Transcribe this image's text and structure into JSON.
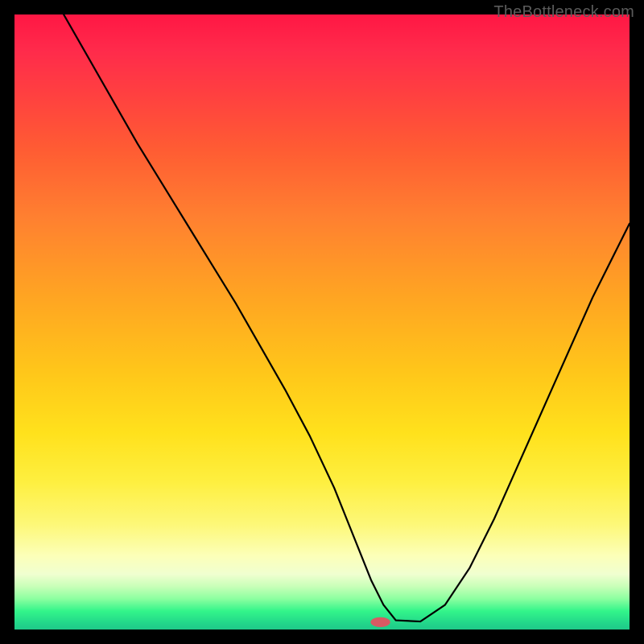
{
  "watermark": "TheBottleneck.com",
  "chart_data": {
    "type": "line",
    "title": "",
    "xlabel": "",
    "ylabel": "",
    "xlim": [
      0,
      100
    ],
    "ylim": [
      0,
      100
    ],
    "grid": false,
    "series": [
      {
        "name": "bottleneck-curve",
        "x": [
          8,
          12,
          16,
          20,
          24,
          28,
          32,
          36,
          40,
          44,
          48,
          52,
          54,
          56,
          58,
          60,
          62,
          66,
          70,
          74,
          78,
          82,
          86,
          90,
          94,
          98,
          100
        ],
        "values": [
          100,
          93,
          86,
          79,
          72.5,
          66,
          59.5,
          53,
          46,
          39,
          31.5,
          23,
          18,
          13,
          8,
          4,
          1.5,
          1.3,
          4,
          10,
          18,
          27,
          36,
          45,
          54,
          62,
          66
        ]
      }
    ],
    "marker": {
      "x": 59.5,
      "y": 1.2,
      "rx": 1.6,
      "ry": 0.8,
      "color": "#d85a63"
    },
    "background_gradient": {
      "stops": [
        {
          "pct": 0,
          "color": "#ff1744"
        },
        {
          "pct": 6,
          "color": "#ff2b4b"
        },
        {
          "pct": 13,
          "color": "#ff4040"
        },
        {
          "pct": 22,
          "color": "#ff5c33"
        },
        {
          "pct": 33,
          "color": "#ff8030"
        },
        {
          "pct": 46,
          "color": "#ffa522"
        },
        {
          "pct": 58,
          "color": "#ffc61a"
        },
        {
          "pct": 68,
          "color": "#ffe11c"
        },
        {
          "pct": 76,
          "color": "#feef40"
        },
        {
          "pct": 83,
          "color": "#fdf879"
        },
        {
          "pct": 88,
          "color": "#fcffb8"
        },
        {
          "pct": 91,
          "color": "#f0ffd0"
        },
        {
          "pct": 93,
          "color": "#c8ffb8"
        },
        {
          "pct": 95,
          "color": "#8cffa0"
        },
        {
          "pct": 97,
          "color": "#33f58a"
        },
        {
          "pct": 99,
          "color": "#22d68a"
        },
        {
          "pct": 100,
          "color": "#1fc989"
        }
      ]
    }
  }
}
